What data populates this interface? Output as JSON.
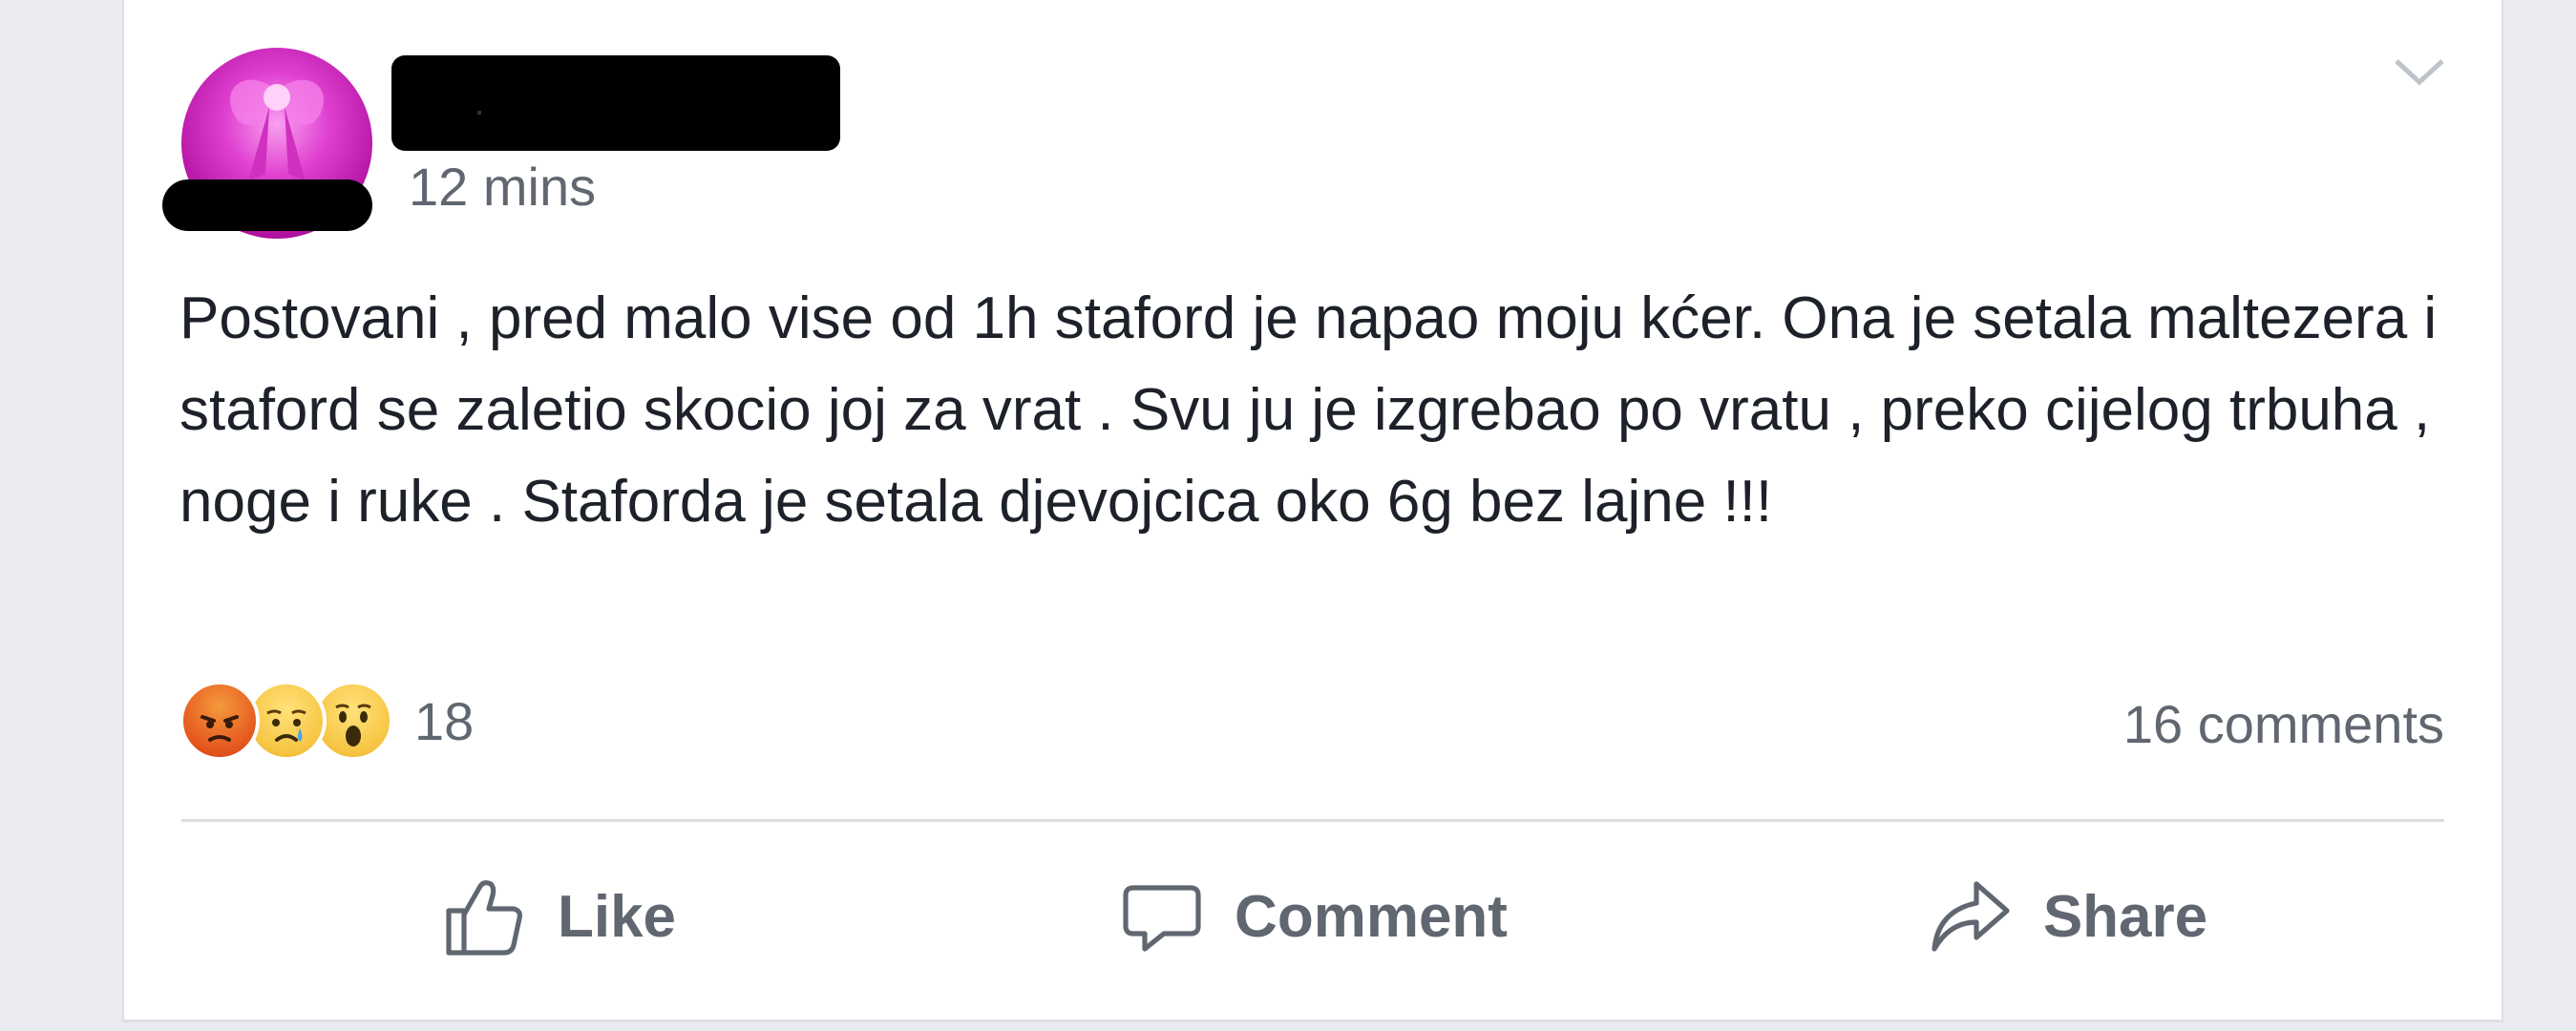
{
  "post": {
    "timestamp": "12 mins",
    "text": "Postovani , pred malo vise od 1h staford je napao moju kćer. Ona je setala maltezera i staford se zaletio skocio joj za vrat . Svu ju je izgrebao po vratu , preko cijelog trbuha , noge i ruke . Staforda je setala djevojcica oko 6g bez lajne !!!",
    "reactions": {
      "icons": [
        "angry-emoji",
        "sad-emoji",
        "wow-emoji"
      ],
      "count": "18"
    },
    "comments_label": "16 comments",
    "actions": {
      "like_label": "Like",
      "comment_label": "Comment",
      "share_label": "Share"
    }
  },
  "colors": {
    "page_bg": "#e9ebee",
    "card_bg": "#ffffff",
    "text": "#1d2129",
    "meta": "#616770",
    "avatar_accent": "#e040d0"
  }
}
